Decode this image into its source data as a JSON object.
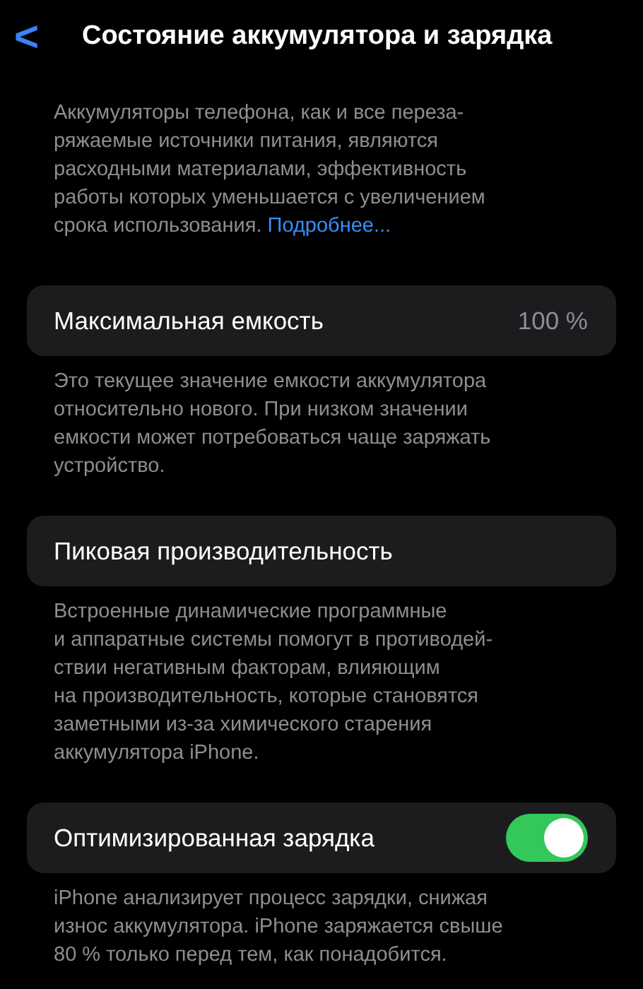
{
  "nav": {
    "back": "<",
    "title": "Состояние аккумулятора и зарядка"
  },
  "intro": {
    "lines": [
      "Аккумуляторы телефона, как и все переза-",
      "ряжаемые источники питания, являются",
      "расходными материалами, эффективность",
      "работы которых уменьшается с увеличением",
      "срока использования."
    ],
    "link": "Подробнее..."
  },
  "sections": [
    {
      "kind": "value",
      "label": "Максимальная емкость",
      "value": "100 %",
      "footer": [
        "Это текущее значение емкости аккумулятора",
        "относительно нового. При низком значении",
        "емкости может потребоваться чаще заряжать",
        "устройство."
      ]
    },
    {
      "kind": "plain",
      "label": "Пиковая производительность",
      "footer": [
        "Встроенные динамические программные",
        "и аппаратные системы помогут в противодей-",
        "ствии негативным факторам, влияющим",
        "на производительность, которые становятся",
        "заметными из-за химического старения",
        "аккумулятора iPhone."
      ]
    },
    {
      "kind": "toggle",
      "label": "Оптимизированная зарядка",
      "on": true,
      "footer": [
        "iPhone анализирует процесс зарядки, снижая",
        "износ аккумулятора. iPhone заряжается свыше",
        "80 % только перед тем, как понадобится."
      ]
    }
  ]
}
